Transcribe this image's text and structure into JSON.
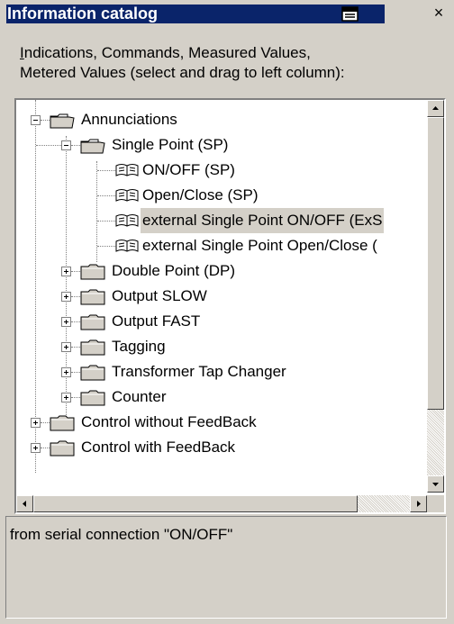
{
  "window": {
    "title": "Information catalog",
    "pin_icon": "pin-icon",
    "close_icon": "close-icon",
    "close_glyph": "×"
  },
  "instructions": {
    "line1_accel": "I",
    "line1_rest": "ndications, Commands, Measured Values,",
    "line2": "Metered Values (select and drag to left column):"
  },
  "tree": {
    "nodes": [
      {
        "label": "Annunciations",
        "icon": "open-folder-icon",
        "expanded": true
      },
      {
        "label": "Single Point (SP)",
        "icon": "open-folder-icon",
        "expanded": true
      },
      {
        "label": "ON/OFF (SP)",
        "icon": "book-icon"
      },
      {
        "label": "Open/Close (SP)",
        "icon": "book-icon"
      },
      {
        "label": "external Single Point ON/OFF (ExS",
        "icon": "book-icon",
        "selected": true
      },
      {
        "label": "external Single Point Open/Close (",
        "icon": "book-icon"
      },
      {
        "label": "Double Point (DP)",
        "icon": "folder-icon",
        "expanded": false
      },
      {
        "label": "Output SLOW",
        "icon": "folder-icon",
        "expanded": false
      },
      {
        "label": "Output FAST",
        "icon": "folder-icon",
        "expanded": false
      },
      {
        "label": "Tagging",
        "icon": "folder-icon",
        "expanded": false
      },
      {
        "label": "Transformer Tap Changer",
        "icon": "folder-icon",
        "expanded": false
      },
      {
        "label": "Counter",
        "icon": "folder-icon",
        "expanded": false
      },
      {
        "label": "Control without FeedBack",
        "icon": "folder-icon",
        "expanded": false
      },
      {
        "label": "Control with FeedBack",
        "icon": "folder-icon",
        "expanded": false
      }
    ]
  },
  "description": {
    "text": "from serial connection \"ON/OFF\""
  },
  "colors": {
    "title_bar": "#0a246a",
    "dialog_bg": "#d4d0c8",
    "selection_bg": "#d4d0c8"
  }
}
